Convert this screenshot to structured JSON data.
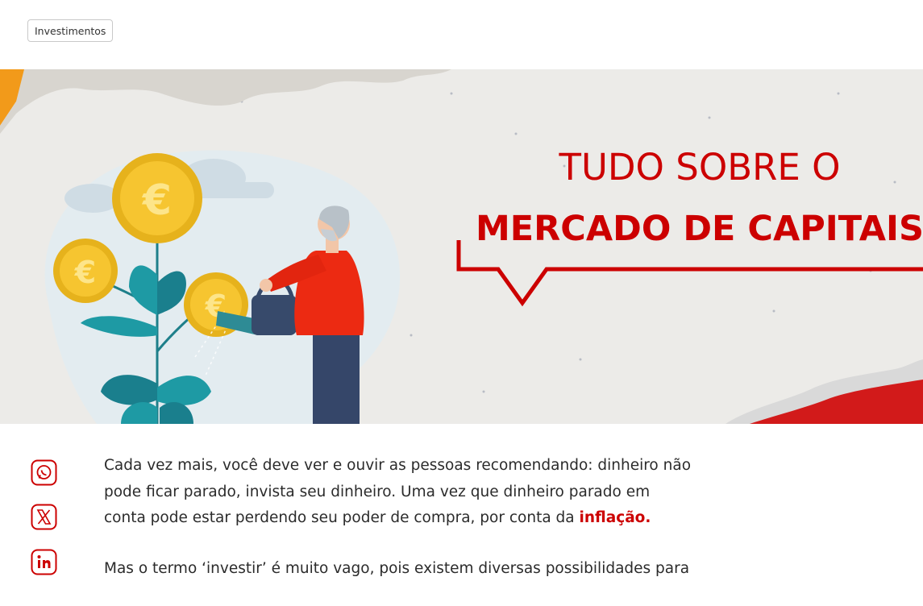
{
  "tag": {
    "label": "Investimentos"
  },
  "hero": {
    "title_line1": "TUDO SOBRE O",
    "title_line2": "MERCADO DE CAPITAIS",
    "coin_symbol": "€",
    "colors": {
      "brand_red": "#cc0000",
      "coin": "#f6c530",
      "shirt": "#ec2a12",
      "leaf": "#1e9aa4"
    }
  },
  "share": [
    {
      "icon": "whatsapp-icon"
    },
    {
      "icon": "x-twitter-icon"
    },
    {
      "icon": "linkedin-icon"
    }
  ],
  "article": {
    "p1_text": "Cada vez mais, você deve ver e ouvir as pessoas recomendando: dinheiro não pode ficar parado, invista seu dinheiro. Uma vez que dinheiro parado em conta pode estar perdendo seu poder de compra, por conta da ",
    "p1_link": "inflação.",
    "p2_text": "Mas o termo ‘investir’ é muito vago, pois existem diversas possibilidades para"
  }
}
